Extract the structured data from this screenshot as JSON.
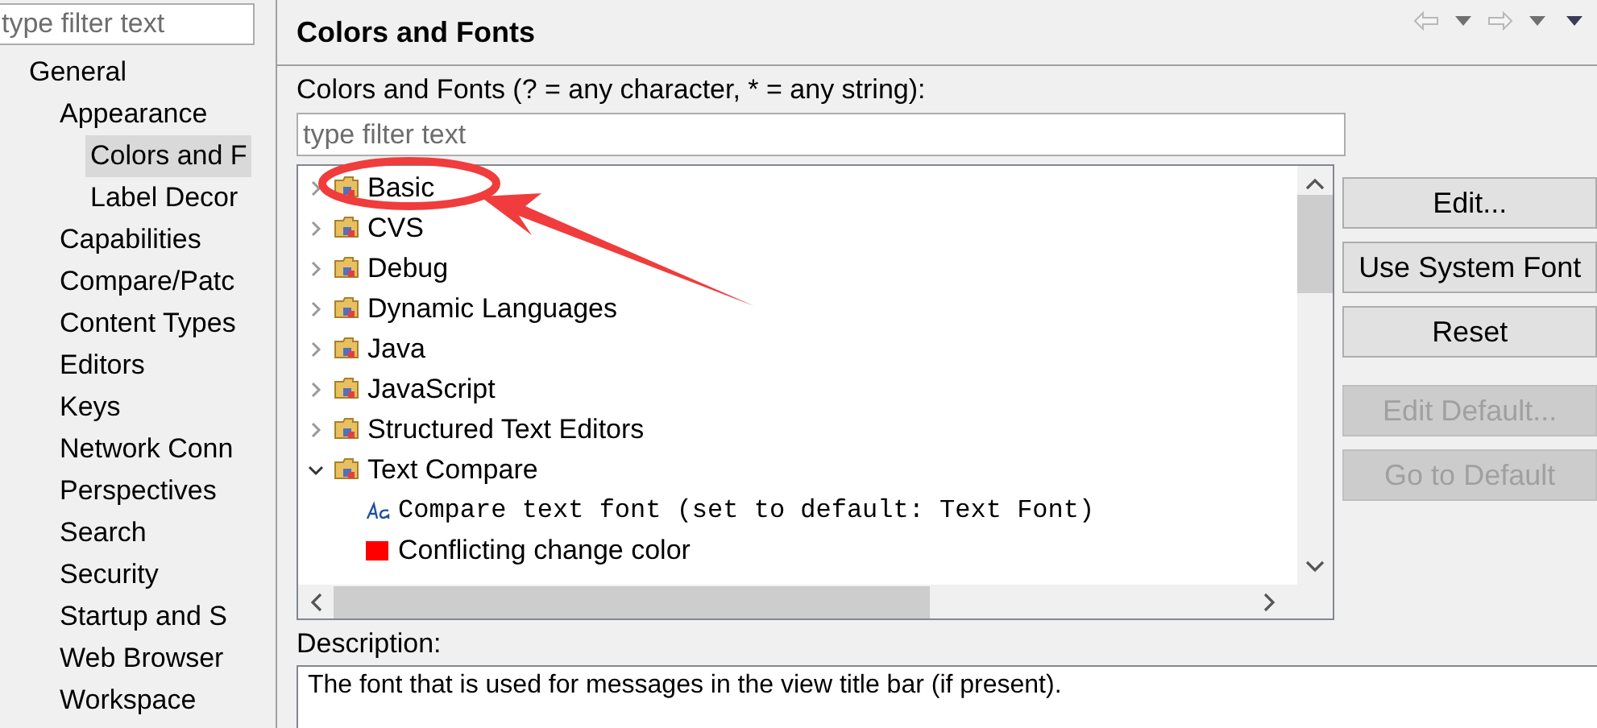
{
  "sidebar": {
    "filter": {
      "placeholder": "type filter text"
    },
    "tree": [
      {
        "label": "General",
        "selected": false,
        "children": [
          {
            "label": "Appearance",
            "selected": false,
            "children": [
              {
                "label": "Colors and F",
                "selected": true
              },
              {
                "label": "Label Decor",
                "selected": false
              }
            ]
          },
          {
            "label": "Capabilities",
            "selected": false
          },
          {
            "label": "Compare/Patc",
            "selected": false
          },
          {
            "label": "Content Types",
            "selected": false
          },
          {
            "label": "Editors",
            "selected": false
          },
          {
            "label": "Keys",
            "selected": false
          },
          {
            "label": "Network Conn",
            "selected": false
          },
          {
            "label": "Perspectives",
            "selected": false
          },
          {
            "label": "Search",
            "selected": false
          },
          {
            "label": "Security",
            "selected": false
          },
          {
            "label": "Startup and S",
            "selected": false
          },
          {
            "label": "Web Browser",
            "selected": false
          },
          {
            "label": "Workspace",
            "selected": false
          }
        ]
      }
    ]
  },
  "page": {
    "title": "Colors and Fonts",
    "filter_label": {
      "text": "Colors and Fonts (? = any character, * = any string):"
    },
    "filter": {
      "placeholder": "type filter text"
    },
    "tree": [
      {
        "label": "Basic",
        "expanded": false
      },
      {
        "label": "CVS",
        "expanded": false
      },
      {
        "label": "Debug",
        "expanded": false
      },
      {
        "label": "Dynamic Languages",
        "expanded": false
      },
      {
        "label": "Java",
        "expanded": false
      },
      {
        "label": "JavaScript",
        "expanded": false
      },
      {
        "label": "Structured Text Editors",
        "expanded": false
      },
      {
        "label": "Text Compare",
        "expanded": true,
        "children": [
          {
            "kind": "font",
            "label": "Compare text font (set to default: Text Font)"
          },
          {
            "kind": "color",
            "label": "Conflicting change color",
            "color": "#ff0000"
          }
        ]
      }
    ],
    "buttons": [
      {
        "label": "Edit...",
        "disabled": false
      },
      {
        "label": "Use System Font",
        "disabled": false
      },
      {
        "label": "Reset",
        "disabled": false
      },
      {
        "label": "Edit Default...",
        "disabled": true
      },
      {
        "label": "Go to Default",
        "disabled": true
      }
    ],
    "description_label": {
      "text": "Description:"
    },
    "description": "The font that is used for messages in the view title bar (if present)."
  }
}
